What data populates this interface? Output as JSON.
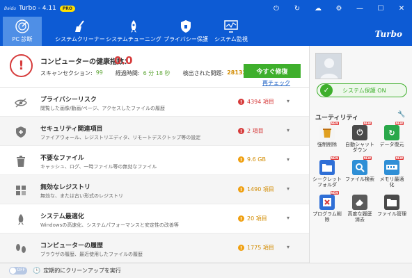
{
  "titlebar": {
    "logo": "Baidu",
    "title": "Turbo - 4.11",
    "badge": "PRO",
    "icons": [
      "power-icon",
      "refresh-icon",
      "cloud-icon",
      "gear-icon",
      "minimize-icon",
      "maximize-icon",
      "close-icon"
    ]
  },
  "nav": {
    "items": [
      {
        "label": "PC 診断",
        "icon": "radar-icon"
      },
      {
        "label": "システムクリーナー",
        "icon": "broom-icon"
      },
      {
        "label": "システムチューニング",
        "icon": "rocket-icon"
      },
      {
        "label": "プライバシー保護",
        "icon": "shield-lock-icon"
      },
      {
        "label": "システム監視",
        "icon": "monitor-icon"
      }
    ],
    "active": 0,
    "brand": "Turbo"
  },
  "summary": {
    "health_label": "コンピューターの健康指数：",
    "health_value": "0.0",
    "scan_label": "スキャンセクション:",
    "scan_value": "99",
    "time_label": "経過時間:",
    "time_value": "6 分 18 秒",
    "issues_label": "検出された問題:",
    "issues_value": "28132",
    "fix_button": "今すぐ修復",
    "recheck": "再チェック"
  },
  "items": [
    {
      "title": "プライバシーリスク",
      "desc": "閲覧した画像/動画/ページ、アクセスしたファイルの履歴",
      "value": "4394 項目",
      "level": "red",
      "icon": "eye-slash-icon"
    },
    {
      "title": "セキュリティ関連項目",
      "desc": "ファイアウォール、レジストリエディタ、リモートデスクトップ等の設定",
      "value": "2 項目",
      "level": "red",
      "icon": "shield-plus-icon"
    },
    {
      "title": "不要なファイル",
      "desc": "キャッシュ、ログ、一時ファイル等の無効なファイル",
      "value": "9.6 GB",
      "level": "orange",
      "icon": "trash-icon"
    },
    {
      "title": "無効なレジストリ",
      "desc": "無効な、または古い形式のレジストリ",
      "value": "1490 項目",
      "level": "orange",
      "icon": "registry-blocks-icon"
    },
    {
      "title": "システム最適化",
      "desc": "Windowsの高速化、システムパフォーマンスと安定性の改善等",
      "value": "20 項目",
      "level": "orange",
      "icon": "rocket-icon"
    },
    {
      "title": "コンピューターの履歴",
      "desc": "ブラウザの履歴、最近使用したファイルの履歴",
      "value": "1775 項目",
      "level": "orange",
      "icon": "footprints-icon"
    }
  ],
  "footer": {
    "toggle": "OFF",
    "text": "定期的にクリーンアップを実行"
  },
  "sidebar": {
    "protection": "システム保護 ON",
    "utility_title": "ユーティリティ",
    "tools": [
      {
        "label": "強制削除",
        "icon": "force-delete-icon",
        "new": true,
        "color": "#f5f5f5"
      },
      {
        "label": "自動シャット\nダウン",
        "icon": "power-timer-icon",
        "new": true,
        "color": "#4a4a4a"
      },
      {
        "label": "データ復元",
        "icon": "data-restore-icon",
        "new": true,
        "color": "#2aa84a"
      },
      {
        "label": "シークレット\nフォルダ",
        "icon": "secret-folder-icon",
        "new": true,
        "color": "#2f6fd6"
      },
      {
        "label": "ファイル検索",
        "icon": "file-search-icon",
        "new": true,
        "color": "#2f8fd6"
      },
      {
        "label": "メモリ最適\n化",
        "icon": "memory-icon",
        "new": true,
        "color": "#2f8fd6"
      },
      {
        "label": "プログラム削\n除",
        "icon": "program-uninstall-icon",
        "new": true,
        "color": "#2f6fd6"
      },
      {
        "label": "高度な履歴\n消去",
        "icon": "history-erase-icon",
        "new": false,
        "color": "#5a5a5a"
      },
      {
        "label": "ファイル管理",
        "icon": "file-manager-icon",
        "new": false,
        "color": "#4a4a4a"
      }
    ],
    "new_badge": "NEW"
  },
  "colors": {
    "primary": "#0d5bd4",
    "nav_active": "#4f8fe6",
    "danger": "#d63a3a",
    "warning": "#f0a010",
    "success": "#3eaf2c"
  }
}
